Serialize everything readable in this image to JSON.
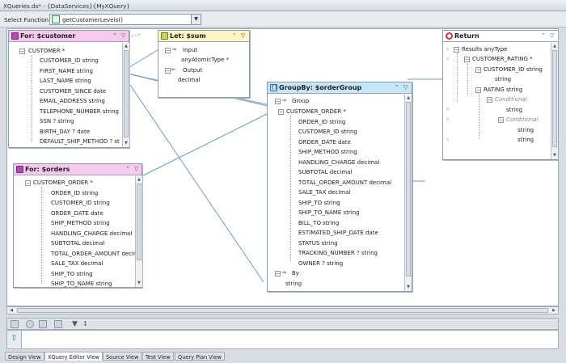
{
  "window": {
    "title": "XQueries.ds* - {DataServices}{MyXQuery}"
  },
  "toolbar": {
    "select_label": "Select Function",
    "function_value": "getCustomerLevels()"
  },
  "for_customer": {
    "title": "For: $customer",
    "root": "CUSTOMER *",
    "fields": [
      "CUSTOMER_ID string",
      "FIRST_NAME string",
      "LAST_NAME string",
      "CUSTOMER_SINCE date",
      "EMAIL_ADDRESS string",
      "TELEPHONE_NUMBER string",
      "SSN ? string",
      "BIRTH_DAY ? date",
      "DEFAULT_SHIP_METHOD ? st"
    ]
  },
  "let_sum": {
    "title": "Let: $sum",
    "input_label": "Input",
    "input_type": "anyAtomicType *",
    "output_label": "Output",
    "output_type": "decimal"
  },
  "for_orders": {
    "title": "For: $orders",
    "root": "CUSTOMER_ORDER *",
    "fields": [
      "ORDER_ID string",
      "CUSTOMER_ID string",
      "ORDER_DATE date",
      "SHIP_METHOD string",
      "HANDLING_CHARGE decimal",
      "SUBTOTAL decimal",
      "TOTAL_ORDER_AMOUNT decim",
      "SALE_TAX decimal",
      "SHIP_TO string",
      "SHIP_TO_NAME string"
    ]
  },
  "groupby": {
    "title": "GroupBy: $orderGroup",
    "group_label": "Group",
    "root": "CUSTOMER_ORDER *",
    "fields": [
      "ORDER_ID string",
      "CUSTOMER_ID string",
      "ORDER_DATE date",
      "SHIP_METHOD string",
      "HANDLING_CHARGE decimal",
      "SUBTOTAL decimal",
      "TOTAL_ORDER_AMOUNT decimal",
      "SALE_TAX decimal",
      "SHIP_TO string",
      "SHIP_TO_NAME string",
      "BILL_TO string",
      "ESTIMATED_SHIP_DATE date",
      "STATUS string",
      "TRACKING_NUMBER ? string",
      "OWNER ? string"
    ],
    "by_label": "By",
    "by_type": "string"
  },
  "return_box": {
    "title": "Return",
    "results": "Results anyType",
    "rating_root": "CUSTOMER_RATING *",
    "customer_id": "CUSTOMER_ID string",
    "customer_id_type": "string",
    "rating": "RATING string",
    "conditional1": "Conditional",
    "str1": "string",
    "conditional2": "Conditional",
    "str2": "string",
    "str3": "string"
  },
  "tabs": [
    "Design View",
    "XQuery Editor View",
    "Source View",
    "Test View",
    "Query Plan View"
  ],
  "colors": {
    "for_header": "#f6c9ef",
    "let_header": "#fbf6c4",
    "groupby_header": "#c6e6f7",
    "return_header": "#ffffff",
    "connector": "#6d9bc2",
    "return_icon": "#c23a3a"
  }
}
